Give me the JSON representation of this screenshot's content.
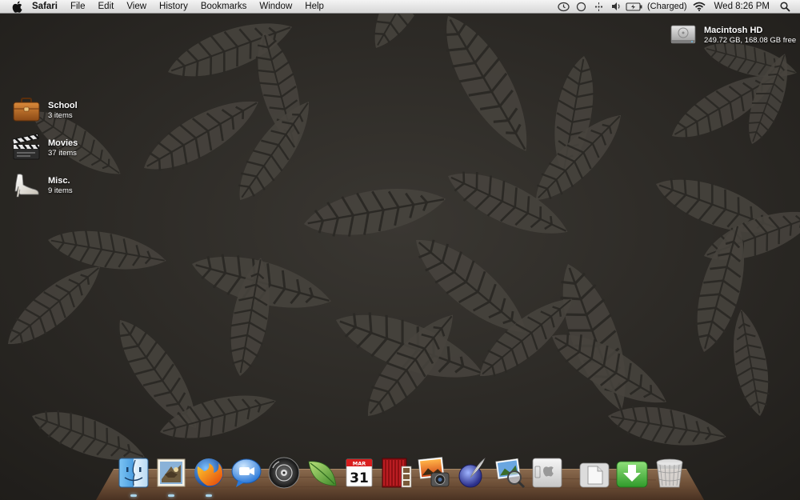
{
  "menubar": {
    "app_name": "Safari",
    "menus": [
      "File",
      "Edit",
      "View",
      "History",
      "Bookmarks",
      "Window",
      "Help"
    ],
    "battery_status": "(Charged)",
    "clock": "Wed 8:26 PM",
    "status_icons": [
      "time-machine-icon",
      "sync-icon",
      "bluetooth-icon",
      "volume-icon",
      "battery-icon",
      "wifi-icon",
      "spotlight-icon"
    ]
  },
  "desktop": {
    "drive": {
      "name": "Macintosh HD",
      "info": "249.72 GB, 168.08 GB free"
    },
    "folders": [
      {
        "name": "School",
        "count": "3 items",
        "icon": "briefcase-icon"
      },
      {
        "name": "Movies",
        "count": "37 items",
        "icon": "clapperboard-icon"
      },
      {
        "name": "Misc.",
        "count": "9 items",
        "icon": "shoe-icon"
      }
    ]
  },
  "dock": {
    "apps": [
      {
        "name": "Finder",
        "icon": "finder-icon",
        "running": true
      },
      {
        "name": "Mail",
        "icon": "mail-icon",
        "running": true
      },
      {
        "name": "Firefox",
        "icon": "firefox-icon",
        "running": true
      },
      {
        "name": "iChat",
        "icon": "ichat-icon",
        "running": false
      },
      {
        "name": "DVD Player",
        "icon": "dvd-player-icon",
        "running": false
      },
      {
        "name": "Leaf App",
        "icon": "leaf-icon",
        "running": false
      },
      {
        "name": "iCal",
        "icon": "calendar-icon",
        "running": false
      },
      {
        "name": "Photo Booth",
        "icon": "photo-booth-icon",
        "running": false
      },
      {
        "name": "iPhoto",
        "icon": "iphoto-icon",
        "running": false
      },
      {
        "name": "Script Editor",
        "icon": "quill-icon",
        "running": false
      },
      {
        "name": "Preview",
        "icon": "preview-icon",
        "running": false
      },
      {
        "name": "Boot Camp",
        "icon": "bootcamp-icon",
        "running": false
      }
    ],
    "calendar_month": "MAR",
    "calendar_day": "31",
    "stacks": [
      {
        "name": "Documents",
        "icon": "documents-stack-icon"
      },
      {
        "name": "Downloads",
        "icon": "downloads-stack-icon"
      },
      {
        "name": "Trash",
        "icon": "trash-icon"
      }
    ]
  },
  "colors": {
    "wallpaper": "#2b2925",
    "leaf": "#4a4640",
    "running_indicator": "#b4e6ff"
  }
}
